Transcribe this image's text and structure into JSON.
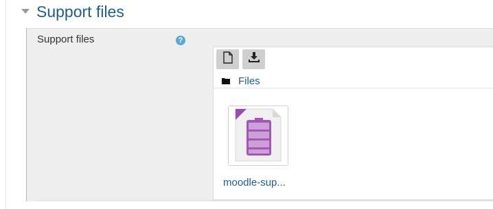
{
  "section": {
    "title": "Support files"
  },
  "field": {
    "label": "Support files",
    "help_icon": "?"
  },
  "filemanager": {
    "toolbar": {
      "add_icon": "file-icon",
      "download_icon": "download-icon"
    },
    "path": {
      "folder_icon": "folder-icon",
      "label": "Files"
    },
    "files": [
      {
        "name": "moodle-sup...",
        "icon": "archive-file-icon"
      }
    ]
  },
  "colors": {
    "link": "#1e5d8c",
    "help": "#5aa8d6",
    "file_accent": "#9a4ab0"
  }
}
